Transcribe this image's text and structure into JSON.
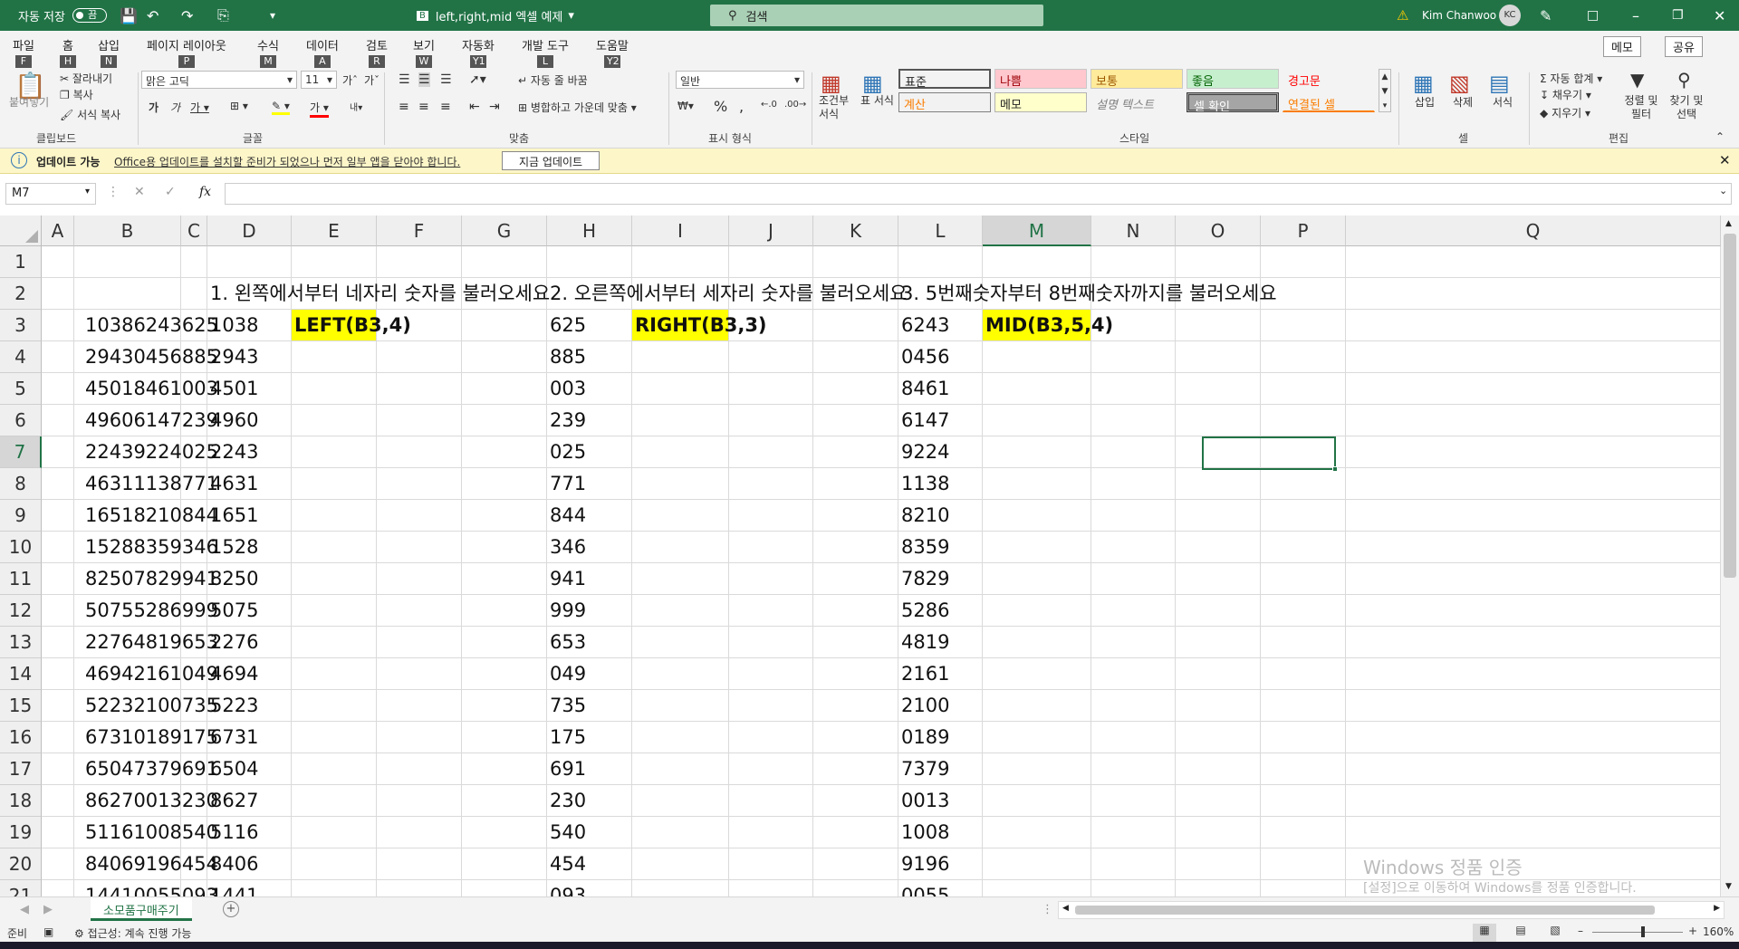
{
  "titlebar": {
    "autosave_label": "자동 저장",
    "autosave_state": "끔",
    "doc_title": "left,right,mid 엑셀 예제",
    "search_placeholder": "검색",
    "user_name": "Kim Chanwoo",
    "user_initials": "KC"
  },
  "ribbon_tabs": [
    {
      "label": "파일",
      "key": "F"
    },
    {
      "label": "홈",
      "key": "H"
    },
    {
      "label": "삽입",
      "key": "N"
    },
    {
      "label": "페이지 레이아웃",
      "key": "P"
    },
    {
      "label": "수식",
      "key": "M"
    },
    {
      "label": "데이터",
      "key": "A"
    },
    {
      "label": "검토",
      "key": "R"
    },
    {
      "label": "보기",
      "key": "W"
    },
    {
      "label": "자동화",
      "key": "Y1"
    },
    {
      "label": "개발 도구",
      "key": "L"
    },
    {
      "label": "도움말",
      "key": "Y2"
    }
  ],
  "ribbon_right": {
    "memo": "메모",
    "share": "공유",
    "memo_key": "ZC",
    "share_key": "ZS"
  },
  "home": {
    "paste": "붙여넣기",
    "cut": "잘라내기",
    "copy": "복사",
    "format_painter": "서식 복사",
    "clipboard_group": "클립보드",
    "font_name": "맑은 고딕",
    "font_size": "11",
    "font_group": "글꼴",
    "wrap_text": "자동 줄 바꿈",
    "merge_center": "병합하고 가운데 맞춤",
    "alignment_group": "맞춤",
    "number_format": "일반",
    "number_group": "표시 형식",
    "cond_format": "조건부 서식",
    "format_table": "표 서식",
    "styles": [
      {
        "label": "표준",
        "bg": "#ffffff",
        "fg": "#000000"
      },
      {
        "label": "나쁨",
        "bg": "#ffc7ce",
        "fg": "#9c0006"
      },
      {
        "label": "보통",
        "bg": "#ffeb9c",
        "fg": "#9c5700"
      },
      {
        "label": "좋음",
        "bg": "#c6efce",
        "fg": "#006100"
      },
      {
        "label": "경고문",
        "bg": "#f3f3f3",
        "fg": "#ff0000"
      },
      {
        "label": "계산",
        "bg": "#f2f2f2",
        "fg": "#fa7d00"
      },
      {
        "label": "메모",
        "bg": "#ffffcc",
        "fg": "#000000"
      },
      {
        "label": "설명 텍스트",
        "bg": "#f3f3f3",
        "fg": "#7f7f7f"
      },
      {
        "label": "셀 확인",
        "bg": "#a5a5a5",
        "fg": "#ffffff"
      },
      {
        "label": "연결된 셀",
        "bg": "#f3f3f3",
        "fg": "#fa7d00"
      }
    ],
    "styles_group": "스타일",
    "insert": "삽입",
    "delete": "삭제",
    "format": "서식",
    "cells_group": "셀",
    "autosum": "자동 합계",
    "fill": "채우기",
    "clear": "지우기",
    "sort_filter": "정렬 및 필터",
    "find_select": "찾기 및 선택",
    "editing_group": "편집"
  },
  "message_bar": {
    "title": "업데이트 가능",
    "text": "Office용 업데이트를 설치할 준비가 되었으나 먼저 일부 앱을 닫아야 합니다.",
    "button": "지금 업데이트"
  },
  "formula_bar": {
    "name_box": "M7",
    "fx": "fx",
    "formula": ""
  },
  "columns": [
    "A",
    "B",
    "C",
    "D",
    "E",
    "F",
    "G",
    "H",
    "I",
    "J",
    "K",
    "L",
    "M",
    "N",
    "O",
    "P",
    "Q"
  ],
  "rows": [
    "1",
    "2",
    "3",
    "4",
    "5",
    "6",
    "7",
    "8",
    "9",
    "10",
    "11",
    "12",
    "13",
    "14",
    "15",
    "16",
    "17",
    "18",
    "19",
    "20",
    "21"
  ],
  "headings": {
    "d": "1. 왼쪽에서부터 네자리 숫자를 불러오세요",
    "h": "2. 오른쪽에서부터 세자리 숫자를 불러오세요",
    "l": "3. 5번째숫자부터 8번째숫자까지를 불러오세요"
  },
  "formulas": {
    "left": "LEFT(B3,4)",
    "right": "RIGHT(B3,3)",
    "mid": "MID(B3,5,4)"
  },
  "data": {
    "b": [
      "10386243625",
      "29430456885",
      "45018461003",
      "49606147239",
      "22439224025",
      "46311138771",
      "16518210844",
      "15288359346",
      "82507829941",
      "50755286999",
      "22764819653",
      "46942161049",
      "52232100735",
      "67310189175",
      "65047379691",
      "86270013230",
      "51161008540",
      "84069196454",
      "14410055093"
    ],
    "d": [
      "1038",
      "2943",
      "4501",
      "4960",
      "2243",
      "4631",
      "1651",
      "1528",
      "8250",
      "5075",
      "2276",
      "4694",
      "5223",
      "6731",
      "6504",
      "8627",
      "5116",
      "8406",
      "1441"
    ],
    "h": [
      "625",
      "885",
      "003",
      "239",
      "025",
      "771",
      "844",
      "346",
      "941",
      "999",
      "653",
      "049",
      "735",
      "175",
      "691",
      "230",
      "540",
      "454",
      "093"
    ],
    "l": [
      "6243",
      "0456",
      "8461",
      "6147",
      "9224",
      "1138",
      "8210",
      "8359",
      "7829",
      "5286",
      "4819",
      "2161",
      "2100",
      "0189",
      "7379",
      "0013",
      "1008",
      "9196",
      "0055"
    ]
  },
  "watermark": {
    "line1": "Windows 정품 인증",
    "line2": "[설정]으로 이동하여 Windows를 정품 인증합니다."
  },
  "sheet_tab": "소모품구매주기",
  "status": {
    "ready": "준비",
    "accessibility": "접근성: 계속 진행 가능",
    "zoom": "160%"
  }
}
